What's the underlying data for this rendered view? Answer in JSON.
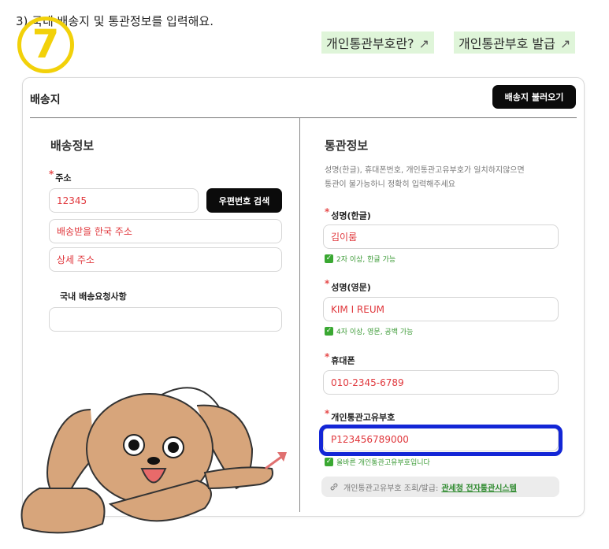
{
  "step": {
    "badge": "7",
    "title": "3) 국내 배송지 및 통관정보를 입력해요."
  },
  "links": [
    {
      "label": "개인통관부호란?",
      "icon": "arrow-up-right-icon",
      "arrow": "↗"
    },
    {
      "label": "개인통관부호 발급",
      "icon": "arrow-up-right-icon",
      "arrow": "↗"
    }
  ],
  "card": {
    "title": "배송지",
    "load_button": "배송지 불러오기"
  },
  "shipping": {
    "section_title": "배송정보",
    "address_label": "주소",
    "postal_code": "12345",
    "zip_search_button": "우편번호 검색",
    "address": "배송받을 한국 주소",
    "address_detail": "상세 주소",
    "request_label": "국내 배송요청사항",
    "request_value": ""
  },
  "customs": {
    "section_title": "통관정보",
    "hint_line1": "성명(한글), 휴대폰번호, 개인통관고유부호가 일치하지않으면",
    "hint_line2": "통관이 불가능하니 정확히 입력해주세요",
    "name_kr_label": "성명(한글)",
    "name_kr": "김이룸",
    "name_kr_check": "2자 이상, 한글 가능",
    "name_en_label": "성명(영문)",
    "name_en": "KIM I REUM",
    "name_en_check": "4자 이상, 영문, 공백 가능",
    "phone_label": "휴대폰",
    "phone": "010-2345-6789",
    "pccc_label": "개인통관고유부호",
    "pccc": "P123456789000",
    "pccc_check": "올바른 개인통관고유부호입니다",
    "lookup_text": "개인통관고유부호 조회/발급:",
    "lookup_link": "관세청 전자통관시스템",
    "lookup_icon": "link-icon",
    "check_icon": "checkbox-checked-icon"
  },
  "colors": {
    "accent_green": "#3aa832",
    "input_text": "#e0373c",
    "highlight_blue": "#1326d6",
    "badge_yellow": "#f2d10a"
  }
}
